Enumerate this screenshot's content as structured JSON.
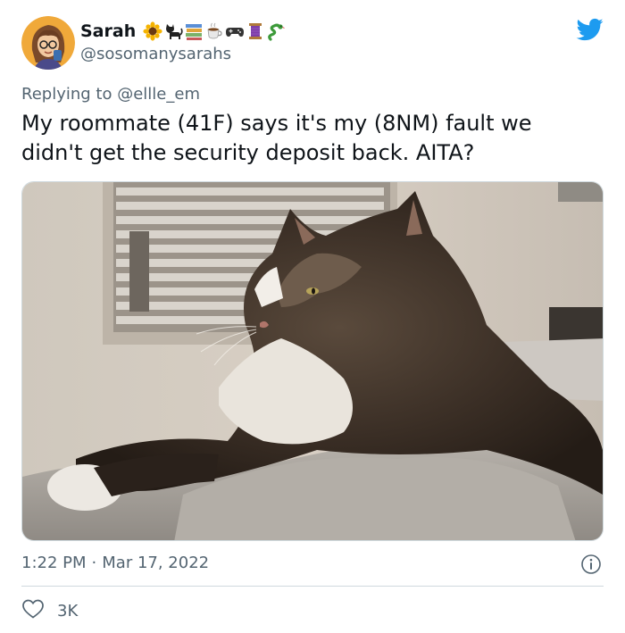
{
  "author": {
    "display_name": "Sarah",
    "handle": "@sosomanysarahs",
    "name_emojis": [
      "sunflower-icon",
      "black-cat-icon",
      "books-icon",
      "coffee-icon",
      "game-controller-icon",
      "thread-spool-icon",
      "snake-icon"
    ]
  },
  "tweet": {
    "reply_prefix": "Replying to",
    "reply_handle": "@ellle_em",
    "text": "My roommate (41F) says it's my (8NM) fault we didn't get the security deposit back. AITA?",
    "time": "1:22 PM",
    "separator": "·",
    "date": "Mar 17, 2022"
  },
  "engagement": {
    "likes": "3K"
  },
  "colors": {
    "brand_blue": "#1d9bf0",
    "secondary_text": "#536471",
    "divider": "#cfd9de",
    "primary_text": "#0f1419"
  }
}
